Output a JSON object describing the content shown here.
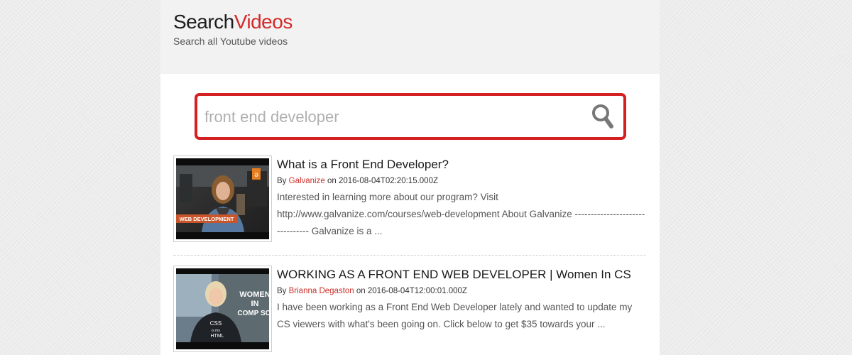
{
  "header": {
    "logo_part1": "Search",
    "logo_part2": "Videos",
    "tagline": "Search all Youtube videos"
  },
  "search": {
    "value": "",
    "placeholder": "front end developer",
    "button_icon": "search-icon"
  },
  "results": [
    {
      "title": "What is a Front End Developer?",
      "by_label": "By",
      "channel": "Galvanize",
      "on_label": "on",
      "date": "2016-08-04T02:20:15.000Z",
      "description": "Interested in learning more about our program? Visit http://www.galvanize.com/courses/web-development About Galvanize -------------------------------- Galvanize is a ...",
      "thumbnail_caption": "WEB DEVELOPMENT"
    },
    {
      "title": "WORKING AS A FRONT END WEB DEVELOPER | Women In CS",
      "by_label": "By",
      "channel": "Brianna Degaston",
      "on_label": "on",
      "date": "2016-08-04T12:00:01.000Z",
      "description": "I have been working as a Front End Web Developer lately and wanted to update my CS viewers with what's been going on. Click below to get $35 towards your ...",
      "thumbnail_caption_lines": [
        "WOMEN",
        "IN",
        "COMP SCI"
      ],
      "shirt_text_lines": [
        "CSS",
        "is my",
        "HTML"
      ]
    }
  ],
  "colors": {
    "accent": "#d32a2a",
    "search_border": "#d42020",
    "channel_link": "#c8302a",
    "badge_orange": "#c9562a"
  }
}
